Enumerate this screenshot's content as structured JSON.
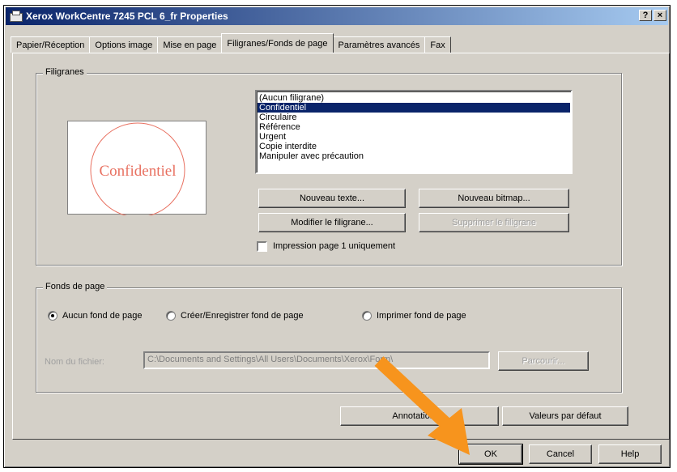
{
  "window": {
    "title": "Xerox WorkCentre 7245 PCL 6_fr Properties",
    "help_btn": "?",
    "close_btn": "×"
  },
  "tabs": [
    {
      "label": "Papier/Réception"
    },
    {
      "label": "Options image"
    },
    {
      "label": "Mise en page"
    },
    {
      "label": "Filigranes/Fonds de page"
    },
    {
      "label": "Paramètres avancés"
    },
    {
      "label": "Fax"
    }
  ],
  "watermarks": {
    "group_label": "Filigranes",
    "preview_text": "Confidentiel",
    "list": [
      "(Aucun filigrane)",
      "Confidentiel",
      "Circulaire",
      "Référence",
      "Urgent",
      "Copie interdite",
      "Manipuler avec précaution"
    ],
    "selected_index": 1,
    "new_text_btn": "Nouveau texte...",
    "new_bitmap_btn": "Nouveau bitmap...",
    "edit_btn": "Modifier le filigrane...",
    "delete_btn": "Supprimer le filigrane",
    "first_page_only": "Impression page 1 uniquement"
  },
  "page_background": {
    "group_label": "Fonds de page",
    "radio_none": "Aucun fond de page",
    "radio_create": "Créer/Enregistrer fond de page",
    "radio_print": "Imprimer fond de page",
    "filename_label": "Nom du fichier:",
    "filename_value": "C:\\Documents and Settings\\All Users\\Documents\\Xerox\\Form\\",
    "browse_btn": "Parcourir..."
  },
  "footer": {
    "annotations_btn": "Annotations...",
    "defaults_btn": "Valeurs par défaut",
    "ok_btn": "OK",
    "cancel_btn": "Cancel",
    "help_btn": "Help"
  },
  "colors": {
    "arrow": "#f7941d",
    "watermark": "#e87060",
    "selection": "#0a246a"
  }
}
